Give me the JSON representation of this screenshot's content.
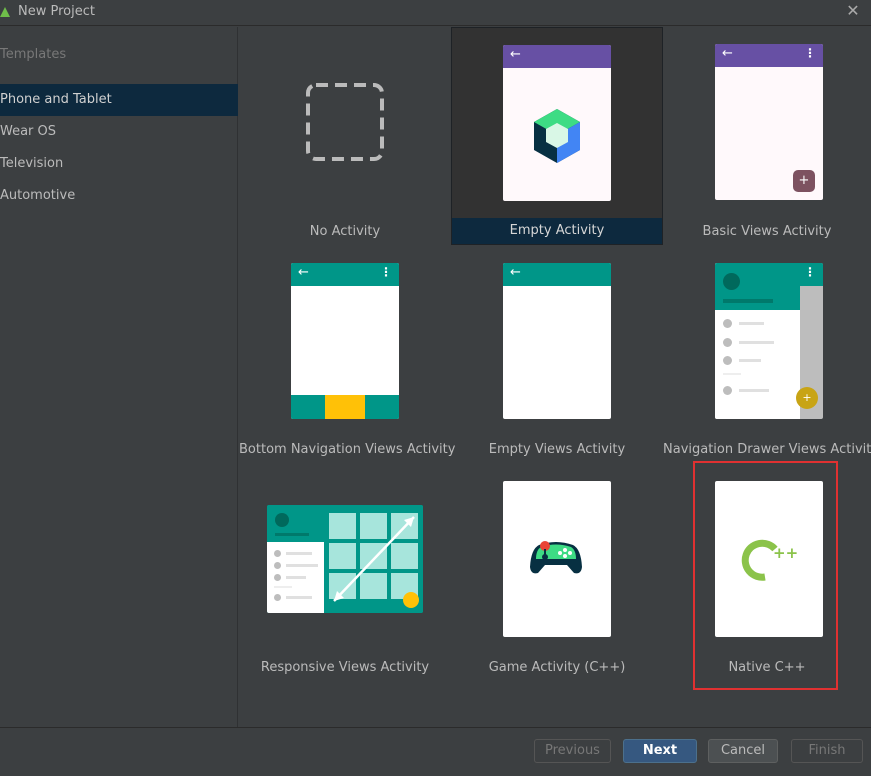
{
  "window": {
    "title": "New Project",
    "close_glyph": "✕"
  },
  "sidebar": {
    "header": "Templates",
    "items": [
      {
        "label": "Phone and Tablet"
      },
      {
        "label": "Wear OS"
      },
      {
        "label": "Television"
      },
      {
        "label": "Automotive"
      }
    ]
  },
  "templates": [
    {
      "label": "No Activity"
    },
    {
      "label": "Empty Activity"
    },
    {
      "label": "Basic Views Activity"
    },
    {
      "label": "Bottom Navigation Views Activity"
    },
    {
      "label": "Empty Views Activity"
    },
    {
      "label": "Navigation Drawer Views Activity"
    },
    {
      "label": "Responsive Views Activity"
    },
    {
      "label": "Game Activity (C++)"
    },
    {
      "label": "Native C++"
    }
  ],
  "thumbnail_glyphs": {
    "back_arrow": "←",
    "overflow_menu": "⋮",
    "fab_plus": "+",
    "cpp_plus": "++"
  },
  "buttons": {
    "previous": "Previous",
    "next": "Next",
    "cancel": "Cancel",
    "finish": "Finish"
  },
  "colors": {
    "accent_purple": "#6750a4",
    "accent_teal": "#009688",
    "accent_yellow": "#ffc107",
    "selection_blue": "#0d293e",
    "primary_button": "#365880",
    "highlight_red": "#e03131"
  }
}
